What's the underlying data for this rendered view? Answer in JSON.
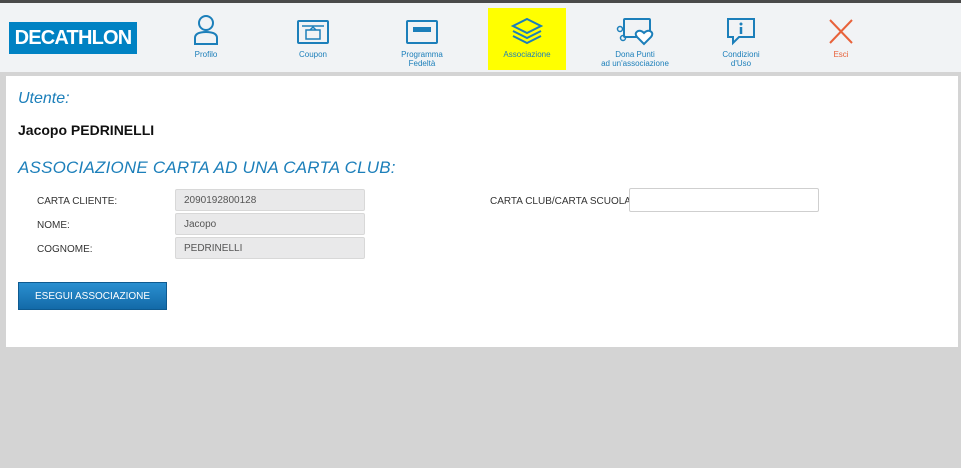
{
  "logo": {
    "text": "DECATHLON"
  },
  "nav": {
    "profile": "Profilo",
    "coupon": "Coupon",
    "loyalty": "Programma\nFedeltà",
    "association": "Associazione",
    "donate": "Dona Punti\nad un'associazione",
    "terms": "Condizioni\nd'Uso",
    "exit": "Esci"
  },
  "main": {
    "user_title": "Utente:",
    "user_name": "Jacopo PEDRINELLI",
    "section_title": "ASSOCIAZIONE CARTA AD UNA CARTA CLUB:",
    "fields": {
      "card_label": "CARTA CLIENTE:",
      "card_value": "2090192800128",
      "name_label": "NOME:",
      "name_value": "Jacopo",
      "surname_label": "COGNOME:",
      "surname_value": "PEDRINELLI",
      "club_label": "CARTA CLUB/CARTA SCUOLA:",
      "club_value": ""
    },
    "button_label": "ESEGUI ASSOCIAZIONE"
  },
  "colors": {
    "accent": "#1c7fba",
    "brand": "#0082c3",
    "active_tab": "#ffff00",
    "exit": "#e8623a"
  }
}
